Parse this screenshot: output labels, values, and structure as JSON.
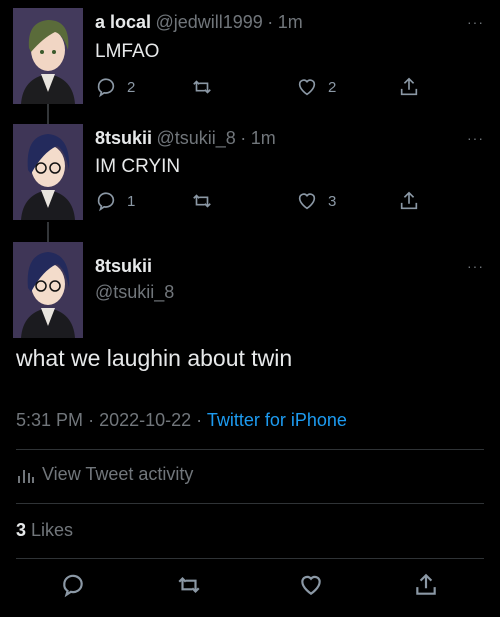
{
  "tweets": [
    {
      "name": "a local",
      "handle": "@jedwill1999",
      "separator": "·",
      "time": "1m",
      "text": "LMFAO",
      "replies": "2",
      "retweets": "",
      "likes": "2",
      "more": "···"
    },
    {
      "name": "8tsukii",
      "handle": "@tsukii_8",
      "separator": "·",
      "time": "1m",
      "text": "IM CRYIN",
      "replies": "1",
      "retweets": "",
      "likes": "3",
      "more": "···"
    }
  ],
  "main_tweet": {
    "name": "8tsukii",
    "handle": "@tsukii_8",
    "text": "what we laughin about twin",
    "time": "5:31 PM",
    "dot1": "·",
    "date": "2022-10-22",
    "dot2": "·",
    "source": "Twitter for iPhone",
    "activity_label": "View Tweet activity",
    "likes_count": "3",
    "likes_label": "Likes",
    "more": "···"
  },
  "icons": {
    "reply": "reply-bubble-icon",
    "retweet": "retweet-icon",
    "like": "heart-icon",
    "share": "share-icon",
    "activity": "bar-chart-icon"
  },
  "colors": {
    "background": "#000000",
    "text": "#e7e9ea",
    "secondary": "#71767b",
    "link": "#1d9bf0"
  }
}
